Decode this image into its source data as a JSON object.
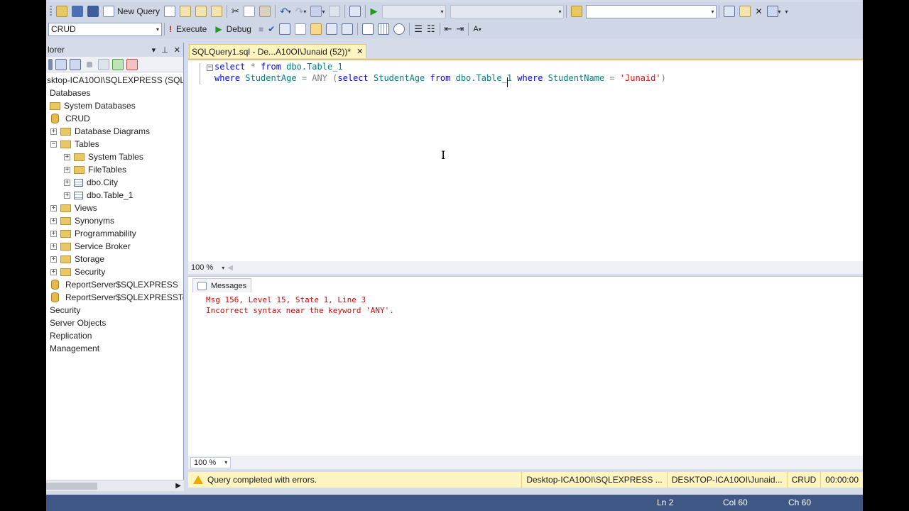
{
  "toolbar1": {
    "new_query_label": "New Query",
    "database_combo_value": "",
    "solution_combo_value": "",
    "find_combo_value": ""
  },
  "toolbar2": {
    "database_value": "CRUD",
    "execute_label": "Execute",
    "debug_label": "Debug"
  },
  "explorer": {
    "title": "lorer",
    "server_node": "sktop-ICA10OI\\SQLEXPRESS (SQL Se",
    "nodes": [
      "Databases",
      "System Databases",
      "CRUD",
      "Database Diagrams",
      "Tables",
      "System Tables",
      "FileTables",
      "dbo.City",
      "dbo.Table_1",
      "Views",
      "Synonyms",
      "Programmability",
      "Service Broker",
      "Storage",
      "Security",
      "ReportServer$SQLEXPRESS",
      "ReportServer$SQLEXPRESSTemp",
      "Security",
      "Server Objects",
      "Replication",
      "Management"
    ]
  },
  "editor": {
    "tab_title": "SQLQuery1.sql - De...A10OI\\Junaid (52))*",
    "line1": {
      "kw1": "select",
      "star": " * ",
      "kw2": "from",
      "obj": " dbo.Table_1"
    },
    "line2": {
      "kw1": "where",
      "col1": " StudentAge ",
      "op": "= ANY (",
      "kw2": "select",
      "col2": " StudentAge ",
      "kw3": "from",
      "obj": " dbo.Table_1 ",
      "kw4": "where",
      "col3": " StudentName ",
      "eq": "= ",
      "str": "'Junaid'",
      "close": ")"
    },
    "zoom": "100 %"
  },
  "results": {
    "tab_label": "Messages",
    "line1": "Msg 156, Level 15, State 1, Line 3",
    "line2": "Incorrect syntax near the keyword 'ANY'.",
    "zoom": "100 %"
  },
  "status": {
    "message": "Query completed with errors.",
    "server": "Desktop-ICA10OI\\SQLEXPRESS ...",
    "user": "DESKTOP-ICA10OI\\Junaid...",
    "database": "CRUD",
    "time": "00:00:00"
  },
  "app_status": {
    "ln": "Ln 2",
    "col": "Col 60",
    "ch": "Ch 60"
  },
  "colors": {
    "keyword": "#0000ff",
    "identifier": "#008080",
    "string": "#ff0000",
    "error_text": "#e00000",
    "status_yellow": "#fdf4bf",
    "app_status_blue": "#3e5785"
  }
}
